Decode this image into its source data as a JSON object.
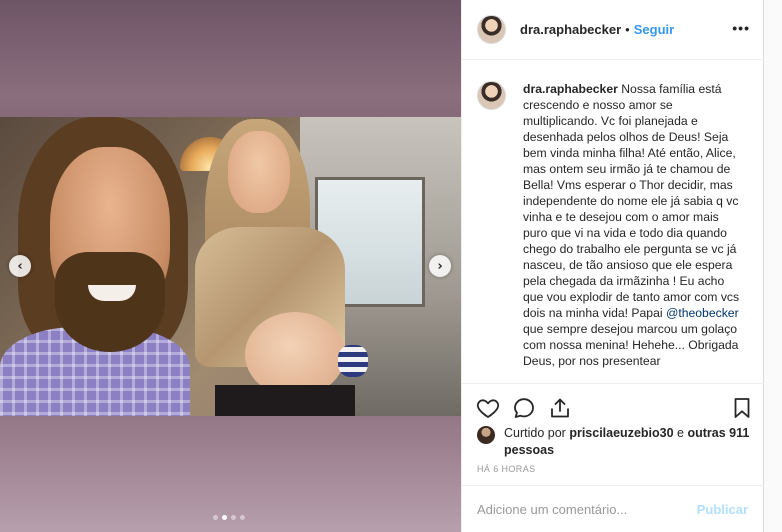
{
  "post": {
    "username": "dra.raphabecker",
    "separator": "•",
    "follow_label": "Seguir",
    "more_label": "•••",
    "caption_parts": {
      "before_mention": "Nossa família está crescendo e nosso amor se multiplicando. Vc foi planejada e desenhada pelos olhos de Deus! Seja bem vinda minha filha! Até então, Alice, mas ontem seu irmão já te chamou de Bella! Vms esperar o Thor decidir, mas independente do nome ele já sabia q vc vinha e te desejou com o amor mais puro que vi na vida e todo dia quando chego do trabalho ele pergunta se vc já nasceu, de tão ansioso que ele espera pela chegada da irmãzinha ! Eu acho que vou explodir de tanto amor com vcs dois na minha vida! Papai",
      "mention": "@theobecker",
      "after_mention": "que sempre desejou marcou um golaço com nossa menina! Hehehe... Obrigada Deus, por nos presentear"
    },
    "carousel": {
      "prev_label": "‹",
      "next_label": "›",
      "slide_count": 4,
      "active_index": 1
    }
  },
  "likes": {
    "prefix": "Curtido por",
    "liker": "priscilaeuzebio30",
    "conjunction": "e",
    "others": "outras 911 pessoas"
  },
  "timestamp": "HÁ 6 HORAS",
  "comment": {
    "placeholder": "Adicione um comentário...",
    "post_label": "Publicar"
  },
  "icons": {
    "like": "heart-outline-icon",
    "comment": "speech-bubble-icon",
    "share": "share-upload-icon",
    "save": "bookmark-icon"
  },
  "colors": {
    "accent": "#3897f0",
    "mention": "#003569",
    "publish_disabled": "#b2dffc",
    "muted": "#999999"
  }
}
